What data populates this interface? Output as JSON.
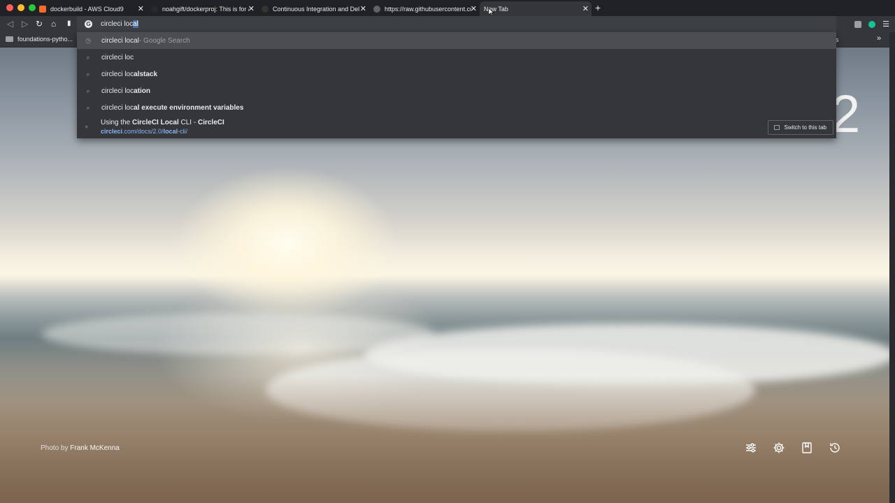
{
  "tabs": [
    {
      "title": "dockerbuild - AWS Cloud9",
      "icon": "aws-cloud9-icon",
      "icon_color": "#f26b2a"
    },
    {
      "title": "noahgift/dockerproj: This is for a d",
      "icon": "github-icon",
      "icon_color": "#24292e"
    },
    {
      "title": "Continuous Integration and Delive",
      "icon": "circleci-icon",
      "icon_color": "#343434"
    },
    {
      "title": "https://raw.githubusercontent.com",
      "icon": "globe-icon",
      "icon_color": "#5f6368"
    },
    {
      "title": "New Tab",
      "icon": "",
      "icon_color": ""
    }
  ],
  "omnibox": {
    "typed": "circleci loc",
    "completion": "al"
  },
  "bookmarks": {
    "first": "foundations-pytho...",
    "right_fragment": "s",
    "overflow": "»"
  },
  "suggestions": [
    {
      "icon": "history-icon",
      "plain": "circleci local",
      "bold": "",
      "suffix": " - Google Search"
    },
    {
      "icon": "search-icon",
      "plain": "circleci loc",
      "bold": "",
      "suffix": ""
    },
    {
      "icon": "search-icon",
      "plain": "circleci loc",
      "bold": "alstack",
      "suffix": ""
    },
    {
      "icon": "search-icon",
      "plain": "circleci loc",
      "bold": "ation",
      "suffix": ""
    },
    {
      "icon": "search-icon",
      "plain": "circleci loc",
      "bold": "al execute environment variables",
      "suffix": ""
    }
  ],
  "tab_suggestion": {
    "prefix": "Using the ",
    "bold1": "CircleCI Local",
    "middle": " CLI - ",
    "bold2": "CircleCI",
    "url_bold1": "circleci",
    "url_mid": ".com/docs/2.0/",
    "url_bold2": "local",
    "url_end": "-cli/",
    "switch_label": "Switch to this tab"
  },
  "clock_fragment": "2",
  "photo_credit": {
    "prefix": "Photo by ",
    "author": "Frank McKenna"
  },
  "bottom_icons": [
    "sliders-icon",
    "gear-icon",
    "bookmark-icon",
    "history-clock-icon"
  ]
}
